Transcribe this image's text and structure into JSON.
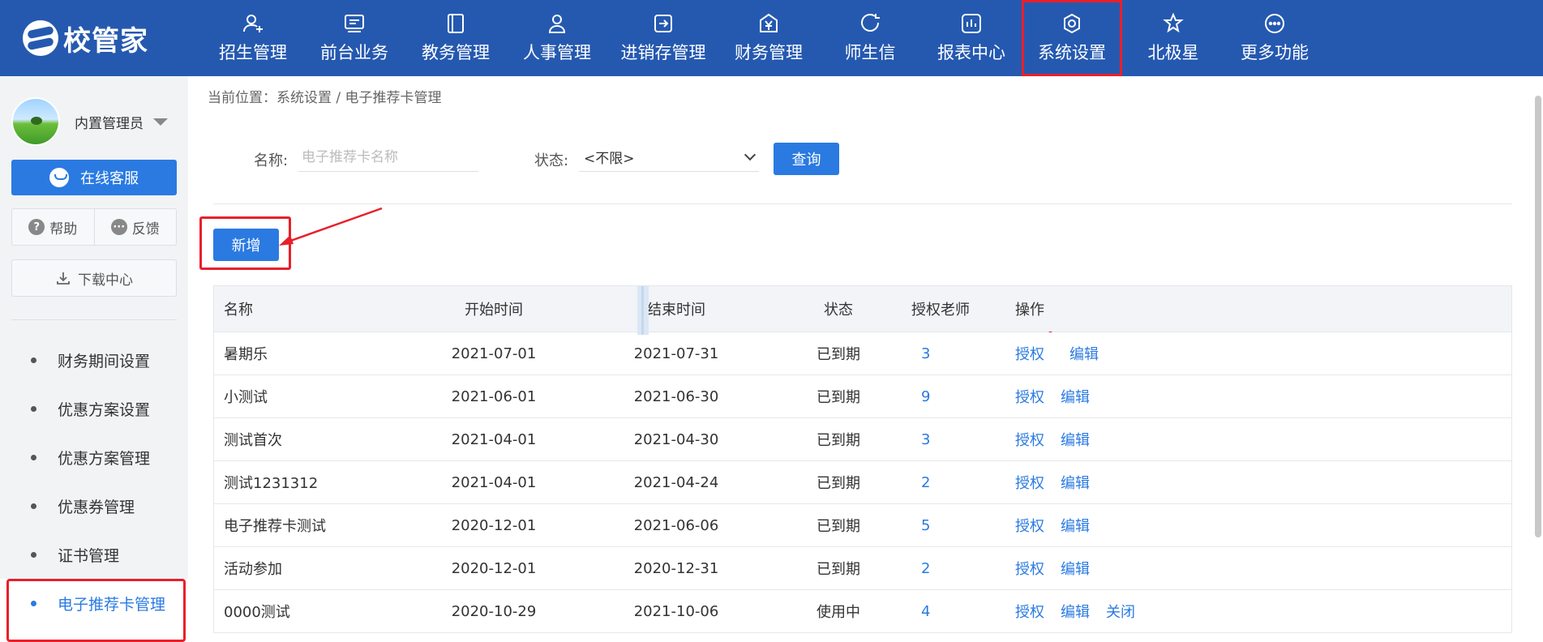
{
  "brand": {
    "name": "校管家"
  },
  "nav": [
    {
      "label": "招生管理",
      "icon": "user-plus-icon"
    },
    {
      "label": "前台业务",
      "icon": "desk-icon"
    },
    {
      "label": "教务管理",
      "icon": "book-icon"
    },
    {
      "label": "人事管理",
      "icon": "person-icon"
    },
    {
      "label": "进销存管理",
      "icon": "inout-icon"
    },
    {
      "label": "财务管理",
      "icon": "yen-icon"
    },
    {
      "label": "师生信",
      "icon": "chat-icon"
    },
    {
      "label": "报表中心",
      "icon": "bar-chart-icon"
    },
    {
      "label": "系统设置",
      "icon": "gear-icon",
      "active": true
    },
    {
      "label": "北极星",
      "icon": "star-icon"
    },
    {
      "label": "更多功能",
      "icon": "more-icon"
    }
  ],
  "sidebar": {
    "user_name": "内置管理员",
    "service_label": "在线客服",
    "help_label": "帮助",
    "feedback_label": "反馈",
    "download_label": "下载中心",
    "menu": [
      {
        "label": "财务期间设置"
      },
      {
        "label": "优惠方案设置"
      },
      {
        "label": "优惠方案管理"
      },
      {
        "label": "优惠券管理"
      },
      {
        "label": "证书管理"
      },
      {
        "label": "电子推荐卡管理",
        "active": true
      }
    ]
  },
  "breadcrumb": "当前位置：系统设置 / 电子推荐卡管理",
  "filter": {
    "name_label": "名称:",
    "name_placeholder": "电子推荐卡名称",
    "status_label": "状态:",
    "status_value": "<不限>",
    "query_label": "查询"
  },
  "add_label": "新增",
  "table": {
    "headers": {
      "name": "名称",
      "start": "开始时间",
      "end": "结束时间",
      "status": "状态",
      "teachers": "授权老师",
      "ops": "操作"
    },
    "op_authorize": "授权",
    "op_edit": "编辑",
    "op_close": "关闭",
    "rows": [
      {
        "name": "暑期乐",
        "start": "2021-07-01",
        "end": "2021-07-31",
        "status": "已到期",
        "teachers": "3"
      },
      {
        "name": "小测试",
        "start": "2021-06-01",
        "end": "2021-06-30",
        "status": "已到期",
        "teachers": "9"
      },
      {
        "name": "测试首次",
        "start": "2021-04-01",
        "end": "2021-04-30",
        "status": "已到期",
        "teachers": "3"
      },
      {
        "name": "测试1231312",
        "start": "2021-04-01",
        "end": "2021-04-24",
        "status": "已到期",
        "teachers": "2"
      },
      {
        "name": "电子推荐卡测试",
        "start": "2020-12-01",
        "end": "2021-06-06",
        "status": "已到期",
        "teachers": "5"
      },
      {
        "name": "活动参加",
        "start": "2020-12-01",
        "end": "2020-12-31",
        "status": "已到期",
        "teachers": "2"
      },
      {
        "name": "0000测试",
        "start": "2020-10-29",
        "end": "2021-10-06",
        "status": "使用中",
        "teachers": "4"
      }
    ]
  },
  "colors": {
    "header_bg": "#2559b0",
    "accent": "#2a7ae2",
    "highlight_red": "#e8202a"
  }
}
